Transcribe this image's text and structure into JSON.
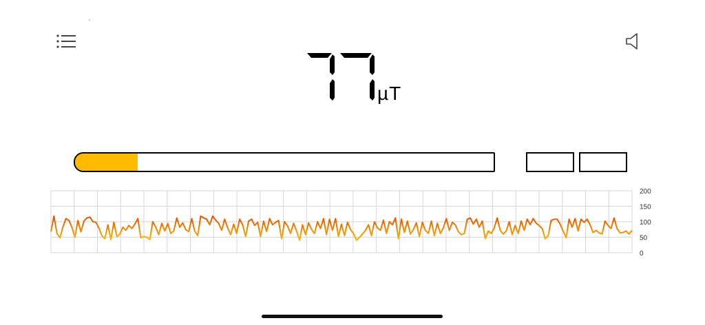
{
  "reading": {
    "value": "77",
    "unit": "µT"
  },
  "meter": {
    "level": 0.15,
    "fill_color": "#ffb900"
  },
  "graph": {
    "y_ticks": [
      "200",
      "150",
      "100",
      "50",
      "0"
    ],
    "line_color_high": "#e35200",
    "line_color_low": "#ffb900"
  },
  "icons": {
    "menu": "list-menu-icon",
    "sound": "speaker-icon"
  },
  "chart_data": {
    "type": "line",
    "ylim": [
      0,
      200
    ],
    "y_ticks": [
      0,
      50,
      100,
      150,
      200
    ],
    "series": [
      {
        "values": [
          68,
          118,
          62,
          48,
          83,
          110,
          104,
          82,
          50,
          104,
          67,
          102,
          112,
          115,
          100,
          98,
          80,
          55,
          45,
          90,
          42,
          98,
          52,
          60,
          82,
          72,
          88,
          78,
          92,
          110,
          48,
          52,
          50,
          42,
          100,
          82,
          58,
          95,
          70,
          94,
          62,
          70,
          112,
          82,
          96,
          74,
          68,
          110,
          70,
          55,
          118,
          112,
          108,
          90,
          118,
          105,
          95,
          72,
          108,
          80,
          58,
          92,
          62,
          108,
          90,
          52,
          102,
          108,
          88,
          98,
          52,
          102,
          68,
          110,
          90,
          98,
          104,
          45,
          100,
          86,
          62,
          95,
          70,
          40,
          90,
          58,
          96,
          75,
          62,
          100,
          78,
          110,
          58,
          108,
          72,
          110,
          52,
          92,
          55,
          98,
          75,
          62,
          40,
          50,
          60,
          72,
          90,
          55,
          100,
          80,
          72,
          105,
          62,
          100,
          90,
          112,
          45,
          108,
          65,
          102,
          60,
          75,
          96,
          52,
          98,
          72,
          62,
          102,
          55,
          95,
          62,
          80,
          110,
          72,
          98,
          90,
          68,
          58,
          62,
          108,
          112,
          92,
          108,
          82,
          102,
          45,
          70,
          62,
          80,
          112,
          72,
          60,
          70,
          100,
          58,
          88,
          62,
          102,
          72,
          108,
          90,
          110,
          95,
          88,
          78,
          45,
          55,
          104,
          108,
          108,
          92,
          70,
          48,
          108,
          82,
          110,
          70,
          108,
          98,
          108,
          90,
          65,
          72,
          64,
          60,
          102,
          88,
          78,
          112,
          78,
          64,
          65,
          70,
          60,
          72
        ]
      }
    ]
  }
}
